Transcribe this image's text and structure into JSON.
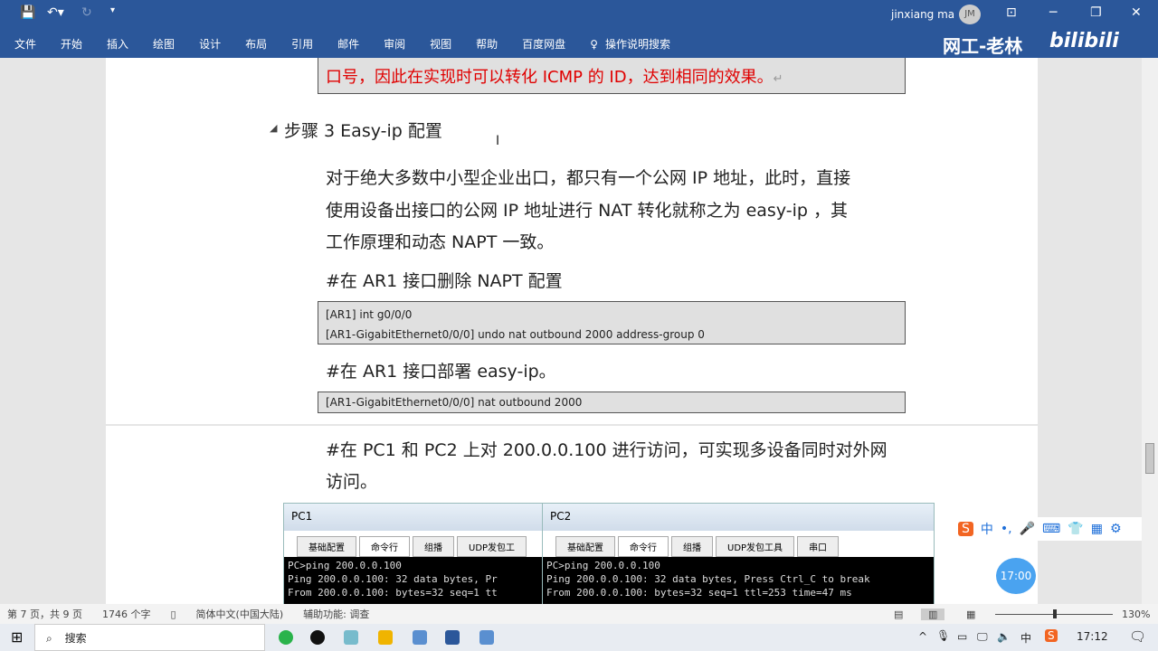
{
  "titlebar": {
    "user": "jinxiang ma",
    "initials": "JM",
    "watermark": "网工-老林",
    "brand": "bilibili"
  },
  "ribbon": {
    "tabs": [
      "文件",
      "开始",
      "插入",
      "绘图",
      "设计",
      "布局",
      "引用",
      "邮件",
      "审阅",
      "视图",
      "帮助",
      "百度网盘"
    ],
    "search": "操作说明搜索"
  },
  "doc": {
    "red_note": "口号，因此在实现时可以转化 ICMP 的 ID，达到相同的效果。",
    "heading": "步骤 3    Easy-ip 配置",
    "para1": [
      "对于绝大多数中小型企业出口，都只有一个公网 IP 地址，此时，直接",
      "使用设备出接口的公网 IP 地址进行 NAT 转化就称之为 easy-ip ，其",
      "工作原理和动态 NAPT 一致。"
    ],
    "step1": "#在 AR1 接口删除 NAPT 配置",
    "code1": [
      "[AR1] int g0/0/0",
      "[AR1-GigabitEthernet0/0/0] undo nat outbound 2000 address-group 0"
    ],
    "step2": "#在 AR1 接口部署 easy-ip。",
    "code2": "[AR1-GigabitEthernet0/0/0] nat outbound 2000",
    "para2": [
      "#在 PC1 和 PC2 上对 200.0.0.100 进行访问，可实现多设备同时对外网",
      "访问。"
    ],
    "pc1": {
      "title": "PC1",
      "tabs": [
        "基础配置",
        "命令行",
        "组播",
        "UDP发包工"
      ],
      "lines": [
        "PC>ping 200.0.0.100",
        "",
        "Ping 200.0.0.100: 32 data bytes, Pr",
        "From 200.0.0.100: bytes=32 seq=1 tt"
      ]
    },
    "pc2": {
      "title": "PC2",
      "tabs": [
        "基础配置",
        "命令行",
        "组播",
        "UDP发包工具",
        "串口"
      ],
      "lines": [
        "PC>ping 200.0.0.100",
        "",
        "Ping 200.0.0.100: 32 data bytes, Press Ctrl_C to break",
        "From 200.0.0.100: bytes=32 seq=1 ttl=253 time=47 ms"
      ]
    }
  },
  "status": {
    "page": "第 7 页，共 9 页",
    "words": "1746 个字",
    "lang": "简体中文(中国大陆)",
    "access": "辅助功能: 调查",
    "zoom": "130%",
    "zoom_percent": 130
  },
  "taskbar": {
    "search": "搜索",
    "time": "17:12",
    "clock_badge": "17:00",
    "ime": "中"
  }
}
